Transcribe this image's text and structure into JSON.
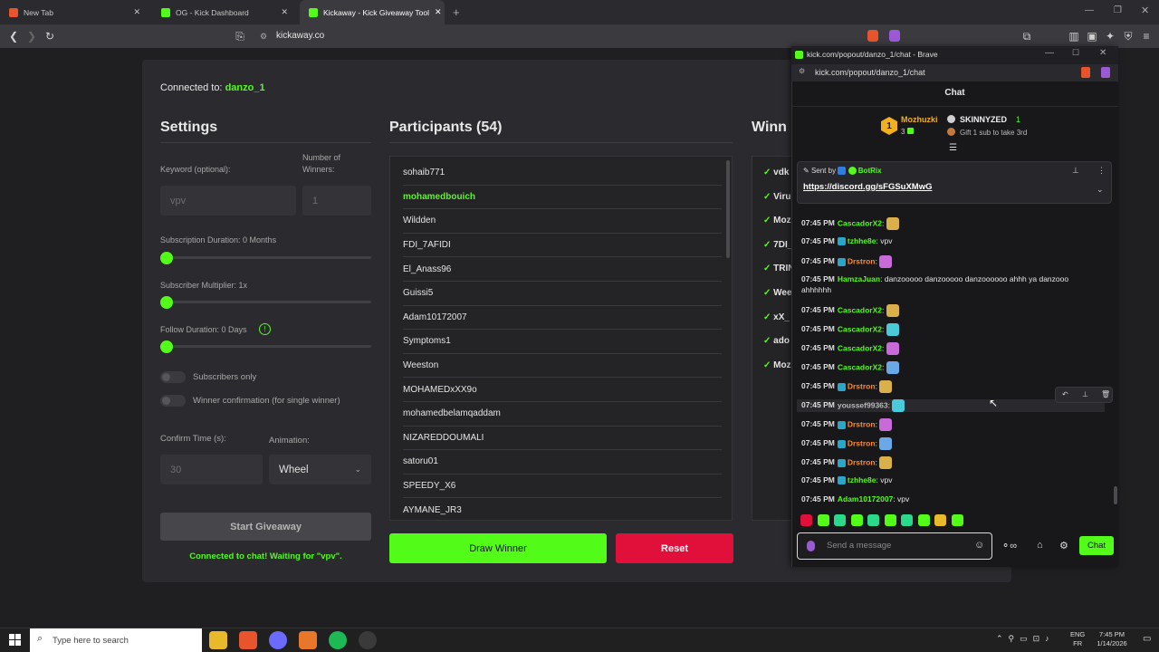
{
  "browser": {
    "tabs": [
      {
        "label": "New Tab"
      },
      {
        "label": "OG - Kick Dashboard"
      },
      {
        "label": "Kickaway - Kick Giveaway Tool"
      }
    ],
    "url": "kickaway.co"
  },
  "app": {
    "connected_label": "Connected to:",
    "connected_user": "danzo_1",
    "settings": {
      "title": "Settings",
      "keyword_label": "Keyword (optional):",
      "keyword_placeholder": "vpv",
      "winners_label": "Number of Winners:",
      "winners_placeholder": "1",
      "sub_duration_label": "Subscription Duration: 0 Months",
      "sub_multiplier_label": "Subscriber Multiplier: 1x",
      "follow_duration_label": "Follow Duration: 0 Days",
      "subscribers_only_label": "Subscribers only",
      "winner_confirmation_label": "Winner confirmation (for single winner)",
      "confirm_time_label": "Confirm Time (s):",
      "confirm_time_placeholder": "30",
      "animation_label": "Animation:",
      "animation_value": "Wheel",
      "start_button": "Start Giveaway",
      "status": "Connected to chat! Waiting for \"vpv\"."
    },
    "participants": {
      "title": "Participants (54)",
      "list": [
        "sohaib771",
        "mohamedbouich",
        "Wildden",
        "FDI_7AFIDI",
        "El_Anass96",
        "Guissi5",
        "Adam10172007",
        "Symptoms1",
        "Weeston",
        "MOHAMEDxXX9o",
        "mohamedbelamqaddam",
        "NIZAREDDOUMALI",
        "satoru01",
        "SPEEDY_X6",
        "AYMANE_JR3"
      ],
      "highlighted": "mohamedbouich",
      "draw_button": "Draw Winner",
      "reset_button": "Reset"
    },
    "winners": {
      "title": "Winn",
      "list": [
        "vdk",
        "Viru",
        "Moz",
        "7DI_",
        "TRIN",
        "Wee",
        "xX_",
        "ado",
        "Moz"
      ]
    }
  },
  "chat_popup": {
    "window_title": "kick.com/popout/danzo_1/chat - Brave",
    "url": "kick.com/popout/danzo_1/chat",
    "header": "Chat",
    "leaderboard": {
      "rank1_name": "Mozhuzki",
      "rank1_count": "3",
      "rank2_name": "SKINNYZED",
      "rank2_count": "1",
      "gift_text": "Gift 1 sub to take 3rd"
    },
    "pinned": {
      "sent_by_label": "Sent by",
      "sender": "BotRix",
      "link": "https://discord.gg/sFGSuXMwG"
    },
    "messages": [
      {
        "time": "07:45 PM",
        "user": "CascadorX2",
        "text": "",
        "color": "#53fc18"
      },
      {
        "time": "07:45 PM",
        "user": "tzhhe8e",
        "text": "vpv",
        "color": "#53fc18"
      },
      {
        "time": "07:45 PM",
        "user": "Drstron",
        "text": "",
        "color": "#ff8a2e"
      },
      {
        "time": "07:45 PM",
        "user": "HamzaJuan",
        "text": "danzooooo danzooooo danzoooooo ahhh ya danzooo",
        "text2": "ahhhhhh",
        "color": "#53fc18"
      },
      {
        "time": "07:45 PM",
        "user": "CascadorX2",
        "text": "",
        "color": "#53fc18"
      },
      {
        "time": "07:45 PM",
        "user": "CascadorX2",
        "text": "",
        "color": "#53fc18"
      },
      {
        "time": "07:45 PM",
        "user": "CascadorX2",
        "text": "",
        "color": "#53fc18"
      },
      {
        "time": "07:45 PM",
        "user": "CascadorX2",
        "text": "",
        "color": "#53fc18"
      },
      {
        "time": "07:45 PM",
        "user": "Drstron",
        "text": "",
        "color": "#ff8a2e"
      },
      {
        "time": "07:45 PM",
        "user": "youssef99363",
        "text": "",
        "color": "#b9b9b9"
      },
      {
        "time": "07:45 PM",
        "user": "Drstron",
        "text": "",
        "color": "#ff8a2e"
      },
      {
        "time": "07:45 PM",
        "user": "Drstron",
        "text": "",
        "color": "#ff8a2e"
      },
      {
        "time": "07:45 PM",
        "user": "Drstron",
        "text": "",
        "color": "#ff8a2e"
      },
      {
        "time": "07:45 PM",
        "user": "tzhhe8e",
        "text": "vpv",
        "color": "#53fc18"
      },
      {
        "time": "07:45 PM",
        "user": "Adam10172007",
        "text": "vpv",
        "color": "#53fc18"
      }
    ],
    "input_placeholder": "Send a message",
    "chat_button": "Chat"
  },
  "taskbar": {
    "search_placeholder": "Type here to search",
    "lang": "ENG",
    "region": "FR",
    "time": "7:45 PM",
    "date": "1/14/2026"
  },
  "colors": {
    "accent": "#53fc18",
    "reset": "#e0103a"
  }
}
